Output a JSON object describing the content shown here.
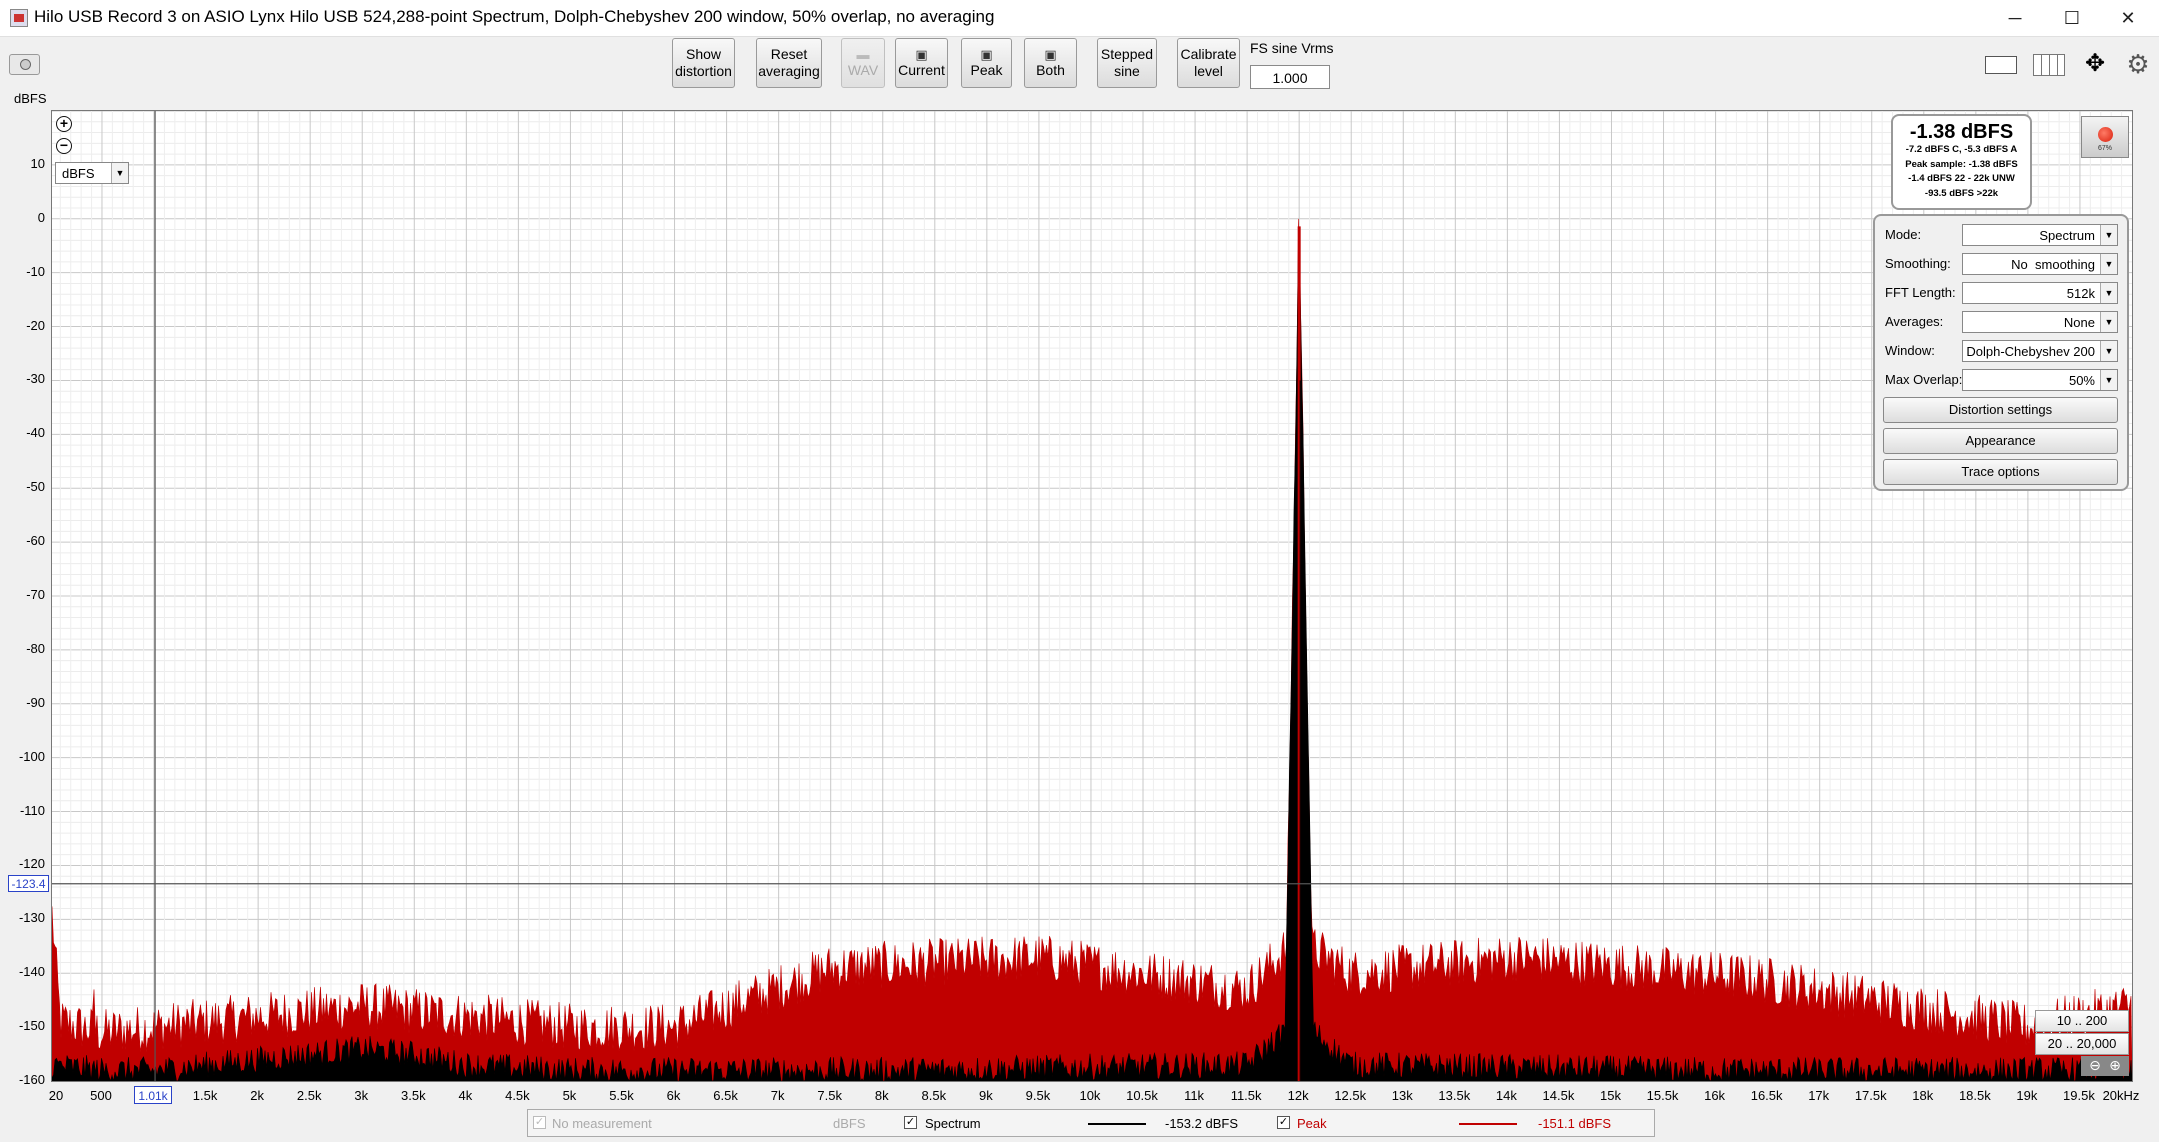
{
  "window": {
    "title": "Hilo USB Record 3 on ASIO Lynx Hilo USB 524,288-point Spectrum, Dolph-Chebyshev 200 window, 50% overlap, no averaging",
    "minimize": "─",
    "maximize": "☐",
    "close": "✕"
  },
  "toolbar": {
    "show_distortion": "Show\ndistortion",
    "reset_averaging": "Reset\naveraging",
    "wav": "WAV",
    "current": "Current",
    "peak": "Peak",
    "both": "Both",
    "stepped_sine": "Stepped\nsine",
    "calibrate_level": "Calibrate\nlevel",
    "fs_label": "FS sine Vrms",
    "fs_value": "1.000"
  },
  "plot": {
    "unit_label": "dBFS",
    "unit_select": "dBFS",
    "cursor_y": "-123.4",
    "cursor_x": "1.01k",
    "y_ticks": [
      "10",
      "0",
      "-10",
      "-20",
      "-30",
      "-40",
      "-50",
      "-60",
      "-70",
      "-80",
      "-90",
      "-100",
      "-110",
      "-120",
      "-130",
      "-140",
      "-150",
      "-160"
    ],
    "x_ticks": [
      "20",
      "500",
      "1k",
      "1.5k",
      "2k",
      "2.5k",
      "3k",
      "3.5k",
      "4k",
      "4.5k",
      "5k",
      "5.5k",
      "6k",
      "6.5k",
      "7k",
      "7.5k",
      "8k",
      "8.5k",
      "9k",
      "9.5k",
      "10k",
      "10.5k",
      "11k",
      "11.5k",
      "12k",
      "12.5k",
      "13k",
      "13.5k",
      "14k",
      "14.5k",
      "15k",
      "15.5k",
      "16k",
      "16.5k",
      "17k",
      "17.5k",
      "18k",
      "18.5k",
      "19k",
      "19.5k",
      "20kHz"
    ]
  },
  "level": {
    "main": "-1.38 dBFS",
    "line1": "-7.2 dBFS C, -5.3 dBFS A",
    "line2": "Peak sample: -1.38 dBFS",
    "line3": "-1.4 dBFS 22 - 22k UNW",
    "line4": "-93.5 dBFS >22k",
    "rec_pct": "67%"
  },
  "settings": {
    "mode_label": "Mode:",
    "mode": "Spectrum",
    "smoothing_label": "Smoothing:",
    "smoothing": "No  smoothing",
    "fft_label": "FFT Length:",
    "fft": "512k",
    "averages_label": "Averages:",
    "averages": "None",
    "window_label": "Window:",
    "window": "Dolph-Chebyshev 200",
    "overlap_label": "Max Overlap:",
    "overlap": "50%",
    "distortion_settings": "Distortion settings",
    "appearance": "Appearance",
    "trace_options": "Trace options"
  },
  "range": {
    "r1": "10 .. 200",
    "r2": "20 .. 20,000"
  },
  "legend": {
    "no_measurement": "No measurement",
    "unit": "dBFS",
    "spectrum": "Spectrum",
    "spectrum_value": "-153.2 dBFS",
    "peak": "Peak",
    "peak_value": "-151.1 dBFS"
  },
  "colors": {
    "peak": "#c00000",
    "spectrum": "#000000",
    "cursor": "#2a43c8"
  },
  "chart_data": {
    "type": "line",
    "xlabel": "",
    "ylabel": "dBFS",
    "xlim": [
      20,
      20000
    ],
    "ylim": [
      -160,
      20
    ],
    "grid": true,
    "series": [
      {
        "name": "Peak",
        "x": [
          20,
          100,
          500,
          1000,
          2000,
          2500,
          3000,
          3500,
          4000,
          5000,
          6000,
          7500,
          9500,
          11500,
          11900,
          12000,
          12100,
          12500,
          14100,
          16400,
          19000,
          20000
        ],
        "y": [
          -129,
          -149,
          -151,
          -150,
          -148,
          -147,
          -146,
          -147,
          -148,
          -150,
          -150,
          -139,
          -137,
          -143,
          -135,
          -1.4,
          -135,
          -140,
          -137,
          -141,
          -150,
          -146
        ]
      },
      {
        "name": "Spectrum",
        "x": [
          20,
          500,
          1000,
          2000,
          2500,
          3000,
          3500,
          4000,
          5000,
          8000,
          11500,
          11900,
          12000,
          12100,
          12500,
          16000,
          20000
        ],
        "y": [
          -157,
          -158,
          -158,
          -156,
          -155,
          -154,
          -155,
          -157,
          -158,
          -158,
          -157,
          -150,
          -1.4,
          -150,
          -157,
          -158,
          -158
        ]
      }
    ]
  }
}
